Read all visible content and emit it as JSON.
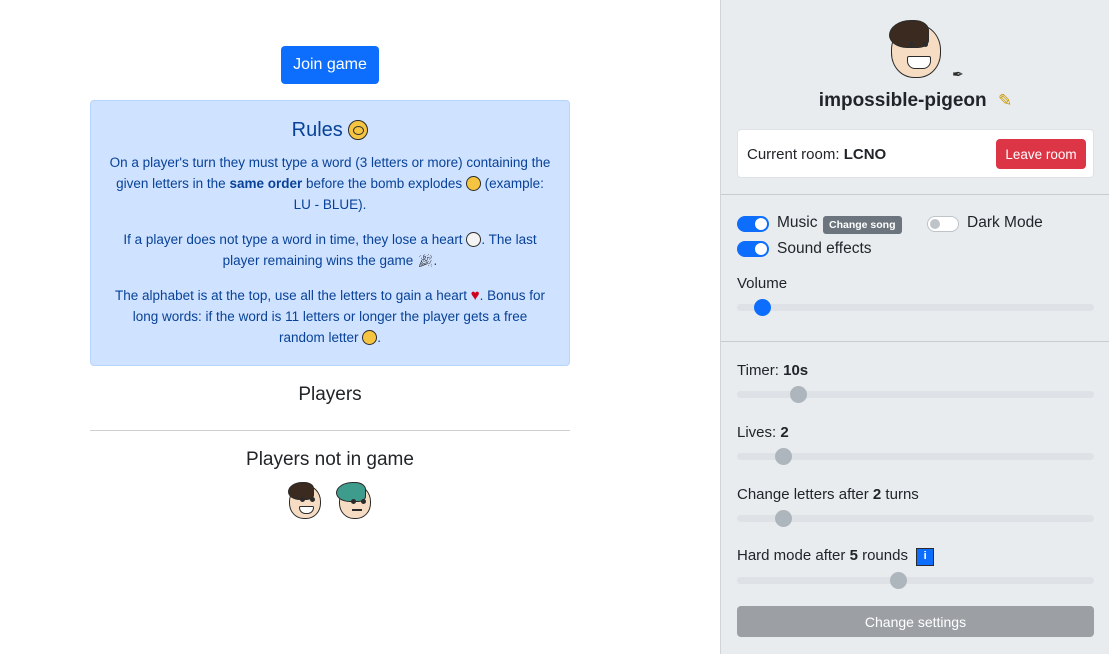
{
  "main": {
    "join_label": "Join game",
    "rules": {
      "title": "Rules",
      "p1_a": "On a player's turn they must type a word (3 letters or more) containing the given letters in the ",
      "p1_bold": "same order",
      "p1_b": " before the bomb explodes ",
      "p1_c": " (example: LU - BLUE).",
      "p2_a": "If a player does not type a word in time, they lose a heart ",
      "p2_b": ". The last player remaining wins the game ",
      "p2_c": ".",
      "p3_a": "The alphabet is at the top, use all the letters to gain a heart ",
      "p3_b": ". Bonus for long words: if the word is 11 letters or longer the player gets a free random letter ",
      "p3_c": "."
    },
    "players_title": "Players",
    "not_in_game_title": "Players not in game"
  },
  "sidebar": {
    "username": "impossible-pigeon",
    "room_label": "Current room: ",
    "room_code": "LCNO",
    "leave_label": "Leave room",
    "music_label": "Music",
    "change_song_label": "Change song",
    "dark_mode_label": "Dark Mode",
    "sound_label": "Sound effects",
    "volume_label": "Volume",
    "volume_value": 0.07,
    "music_on": true,
    "sound_on": true,
    "dark_mode_on": false,
    "timer_label": "Timer: ",
    "timer_value": "10s",
    "timer_fill": 0.17,
    "lives_label": "Lives: ",
    "lives_value": "2",
    "lives_fill": 0.13,
    "change_letters_a": "Change letters after ",
    "change_letters_value": "2",
    "change_letters_b": " turns",
    "change_letters_fill": 0.13,
    "hard_mode_a": "Hard mode after ",
    "hard_mode_value": "5",
    "hard_mode_b": " rounds",
    "hard_mode_fill": 0.45,
    "info_icon_text": "i",
    "change_settings_label": "Change settings"
  },
  "colors": {
    "primary": "#0d6efd",
    "danger": "#dc3545",
    "rules_bg": "#cfe2ff",
    "sidebar_bg": "#e9ecef"
  },
  "icons": [
    "pencil-icon",
    "heart-icon",
    "skull-icon",
    "trophy-icon",
    "nerd-face-icon",
    "shocked-face-icon",
    "rules-face-icon",
    "info-icon"
  ]
}
